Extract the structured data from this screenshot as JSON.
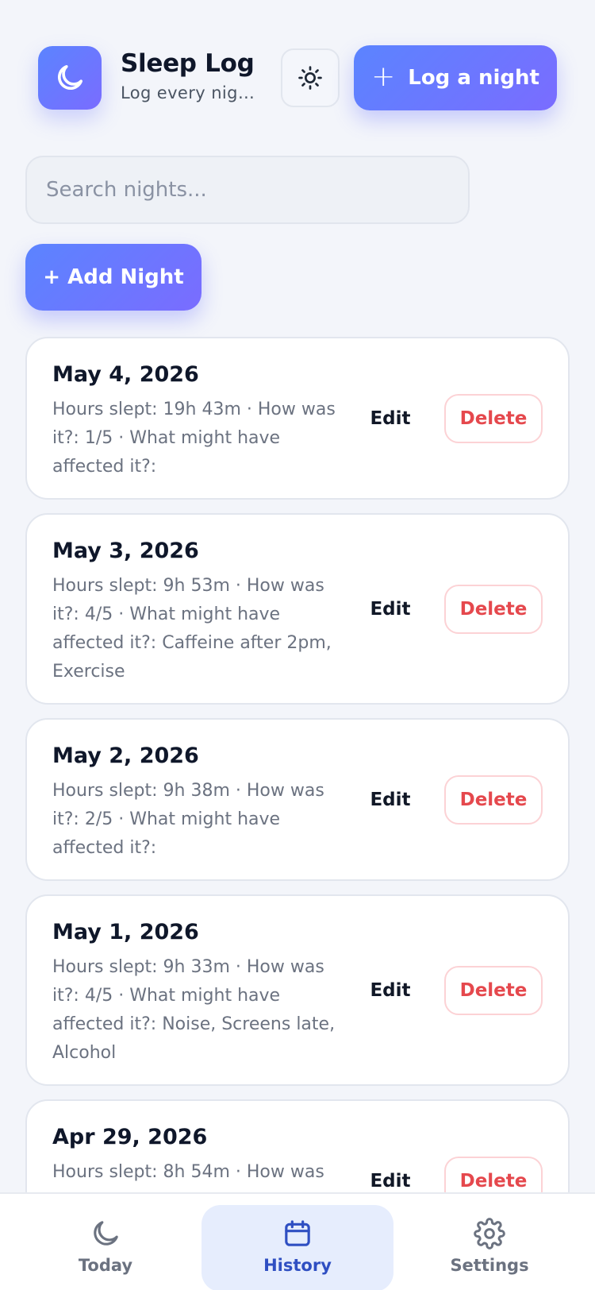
{
  "header": {
    "title": "Sleep Log",
    "subtitle": "Log every night and see what helps.",
    "theme_toggle_icon": "sun-icon",
    "log_button_label": "Log a night"
  },
  "search": {
    "placeholder": "Search nights...",
    "value": ""
  },
  "add_button_label": "+ Add Night",
  "entries": [
    {
      "date": "May 4, 2026",
      "details": "Hours slept: 19h 43m · How was it?: 1/5 · What might have affected it?:",
      "edit_label": "Edit",
      "delete_label": "Delete"
    },
    {
      "date": "May 3, 2026",
      "details": "Hours slept: 9h 53m · How was it?: 4/5 · What might have affected it?: Caffeine after 2pm, Exercise",
      "edit_label": "Edit",
      "delete_label": "Delete"
    },
    {
      "date": "May 2, 2026",
      "details": "Hours slept: 9h 38m · How was it?: 2/5 · What might have affected it?:",
      "edit_label": "Edit",
      "delete_label": "Delete"
    },
    {
      "date": "May 1, 2026",
      "details": "Hours slept: 9h 33m · How was it?: 4/5 · What might have affected it?: Noise, Screens late, Alcohol",
      "edit_label": "Edit",
      "delete_label": "Delete"
    },
    {
      "date": "Apr 29, 2026",
      "details": "Hours slept: 8h 54m · How was",
      "edit_label": "Edit",
      "delete_label": "Delete"
    }
  ],
  "nav": {
    "items": [
      {
        "label": "Today",
        "icon": "moon-icon",
        "active": false
      },
      {
        "label": "History",
        "icon": "calendar-icon",
        "active": true
      },
      {
        "label": "Settings",
        "icon": "gear-icon",
        "active": false
      }
    ]
  },
  "colors": {
    "accent_gradient_start": "#5b84ff",
    "accent_gradient_end": "#7a6cff",
    "delete_red": "#e5484d",
    "active_nav_bg": "#e6edfd",
    "active_nav_text": "#2f4fc2"
  }
}
